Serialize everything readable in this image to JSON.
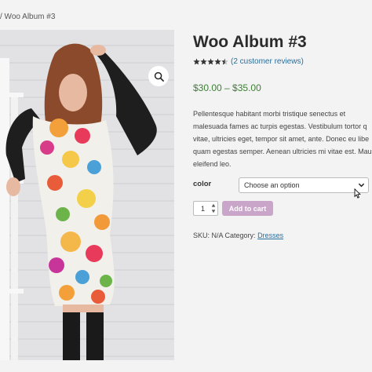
{
  "breadcrumb": {
    "text": "/ Woo Album #3"
  },
  "gallery": {
    "zoom_icon": "magnifier-icon",
    "image_alt": "Woman in floral dress"
  },
  "product": {
    "title": "Woo Album #3",
    "rating": {
      "value": 4.5,
      "max": 5,
      "reviews_link": "(2 customer reviews)"
    },
    "price": "$30.00 – $35.00",
    "description": [
      "Pellentesque habitant morbi tristique senectus et",
      "malesuada fames ac turpis egestas. Vestibulum tortor q",
      "vitae, ultricies eget, tempor sit amet, ante. Donec eu libe",
      "quam egestas semper. Aenean ultricies mi vitae est. Mau",
      "eleifend leo."
    ],
    "variation": {
      "label": "color",
      "selected": "Choose an option"
    },
    "quantity": "1",
    "add_to_cart": "Add to cart",
    "meta": {
      "sku_prefix": "SKU: N/A Category:",
      "category": "Dresses"
    }
  },
  "colors": {
    "link": "#2a6e9a",
    "price": "#3d7e34",
    "button": "#c9a5c9",
    "stars": "#333333"
  }
}
